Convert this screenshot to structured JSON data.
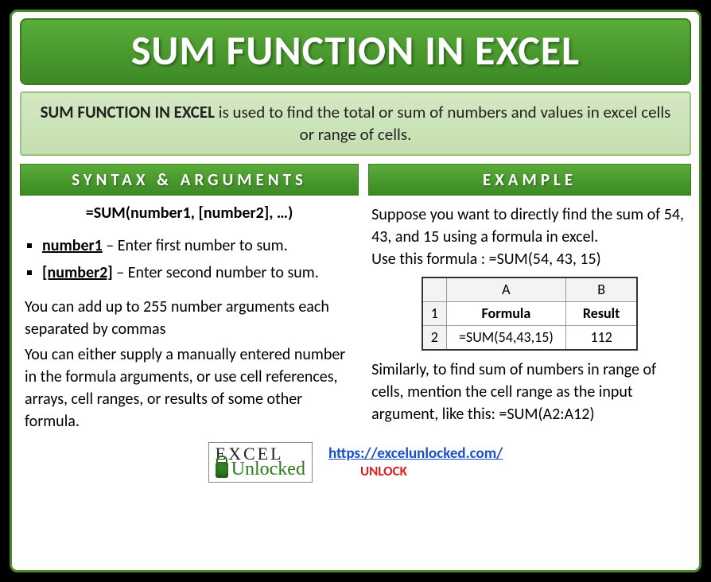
{
  "title": "SUM FUNCTION IN EXCEL",
  "intro": {
    "lead": "SUM FUNCTION IN EXCEL",
    "rest": " is used to find the total or sum of numbers and values in excel cells or range of cells."
  },
  "syntax": {
    "header": "SYNTAX & ARGUMENTS",
    "formula": "=SUM(number1, [number2], …)",
    "args": [
      {
        "name": "number1",
        "desc": " – Enter first number to sum."
      },
      {
        "name": "[number2]",
        "desc": " – Enter second number to sum."
      }
    ],
    "note1": "You can add up to 255 number arguments each separated by commas",
    "note2": "You can either supply a manually entered number in the formula arguments, or use cell references, arrays, cell ranges, or results of some other formula."
  },
  "example": {
    "header": "EXAMPLE",
    "p1": "Suppose you want to directly find the sum of 54, 43, and 15 using a formula in excel.",
    "p2": "Use this formula : =SUM(54, 43, 15)",
    "table": {
      "colA": "A",
      "colB": "B",
      "row1": "1",
      "row2": "2",
      "h1": "Formula",
      "h2": "Result",
      "c1": "=SUM(54,43,15)",
      "c2": "112"
    },
    "p3": "Similarly, to find sum of numbers in range of cells, mention the cell range as the input argument, like this: =SUM(A2:A12)"
  },
  "footer": {
    "logo1": "EXCEL",
    "logo2": "Unlocked",
    "url": "https://excelunlocked.com/",
    "unlock": "UNLOCK"
  }
}
